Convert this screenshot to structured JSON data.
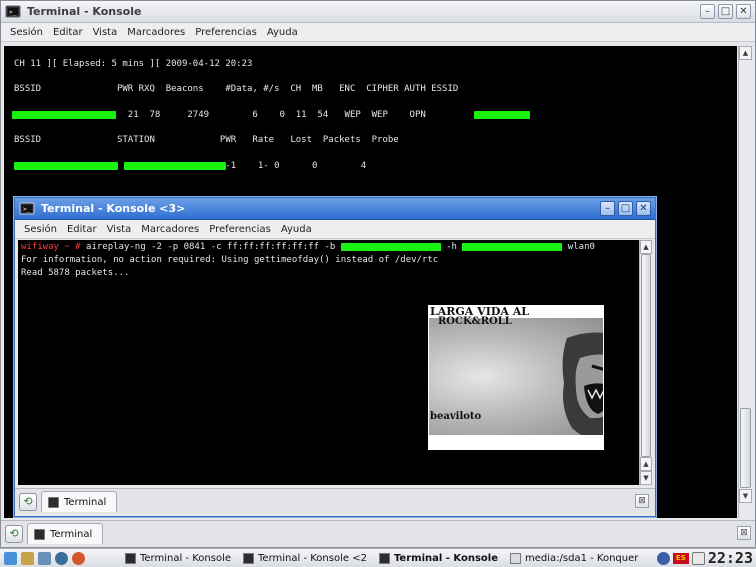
{
  "outer_window": {
    "title": "Terminal - Konsole",
    "menu": [
      "Sesión",
      "Editar",
      "Vista",
      "Marcadores",
      "Preferencias",
      "Ayuda"
    ],
    "terminal": {
      "status_line": "CH 11 ][ Elapsed: 5 mins ][ 2009-04-12 20:23",
      "ap_header": "BSSID              PWR RXQ  Beacons    #Data, #/s  CH  MB   ENC  CIPHER AUTH ESSID",
      "ap_row": "                     21  78     2749        6    0  11  54   WEP  WEP    OPN",
      "station_header": "BSSID              STATION            PWR   Rate   Lost  Packets  Probe",
      "station_row": "                                       -1    1- 0      0        4"
    },
    "tab_label": "Terminal"
  },
  "inner_window": {
    "title": "Terminal - Konsole <3>",
    "menu": [
      "Sesión",
      "Editar",
      "Vista",
      "Marcadores",
      "Preferencias",
      "Ayuda"
    ],
    "terminal": {
      "prompt": "wifiway ~ # ",
      "command": "aireplay-ng -2 -p 0841 -c ff:ff:ff:ff:ff:ff -b ",
      "command_h": " -h ",
      "command_tail": " wlan0",
      "line2": "For information, no action required: Using gettimeofday() instead of /dev/rtc",
      "line3": "Read 5878 packets..."
    },
    "image_caption_top": "LARGA VIDA AL",
    "image_caption_mid": "ROCK&ROLL",
    "image_caption_bottom": "beaviloto",
    "tab_label": "Terminal"
  },
  "taskbar": {
    "tasks": [
      {
        "label": "Terminal - Konsole",
        "active": false
      },
      {
        "label": "Terminal - Konsole <2",
        "active": false
      },
      {
        "label": "Terminal - Konsole",
        "active": true
      },
      {
        "label": "media:/sda1 - Konquer",
        "active": false
      }
    ],
    "keyboard_layout": "ES",
    "clock": "22:23"
  },
  "colors": {
    "prompt_red": "#ff3b3b",
    "redaction_green": "#17f30f",
    "terminal_bg": "#000000",
    "inner_title_blue": "#2f6fd0"
  }
}
